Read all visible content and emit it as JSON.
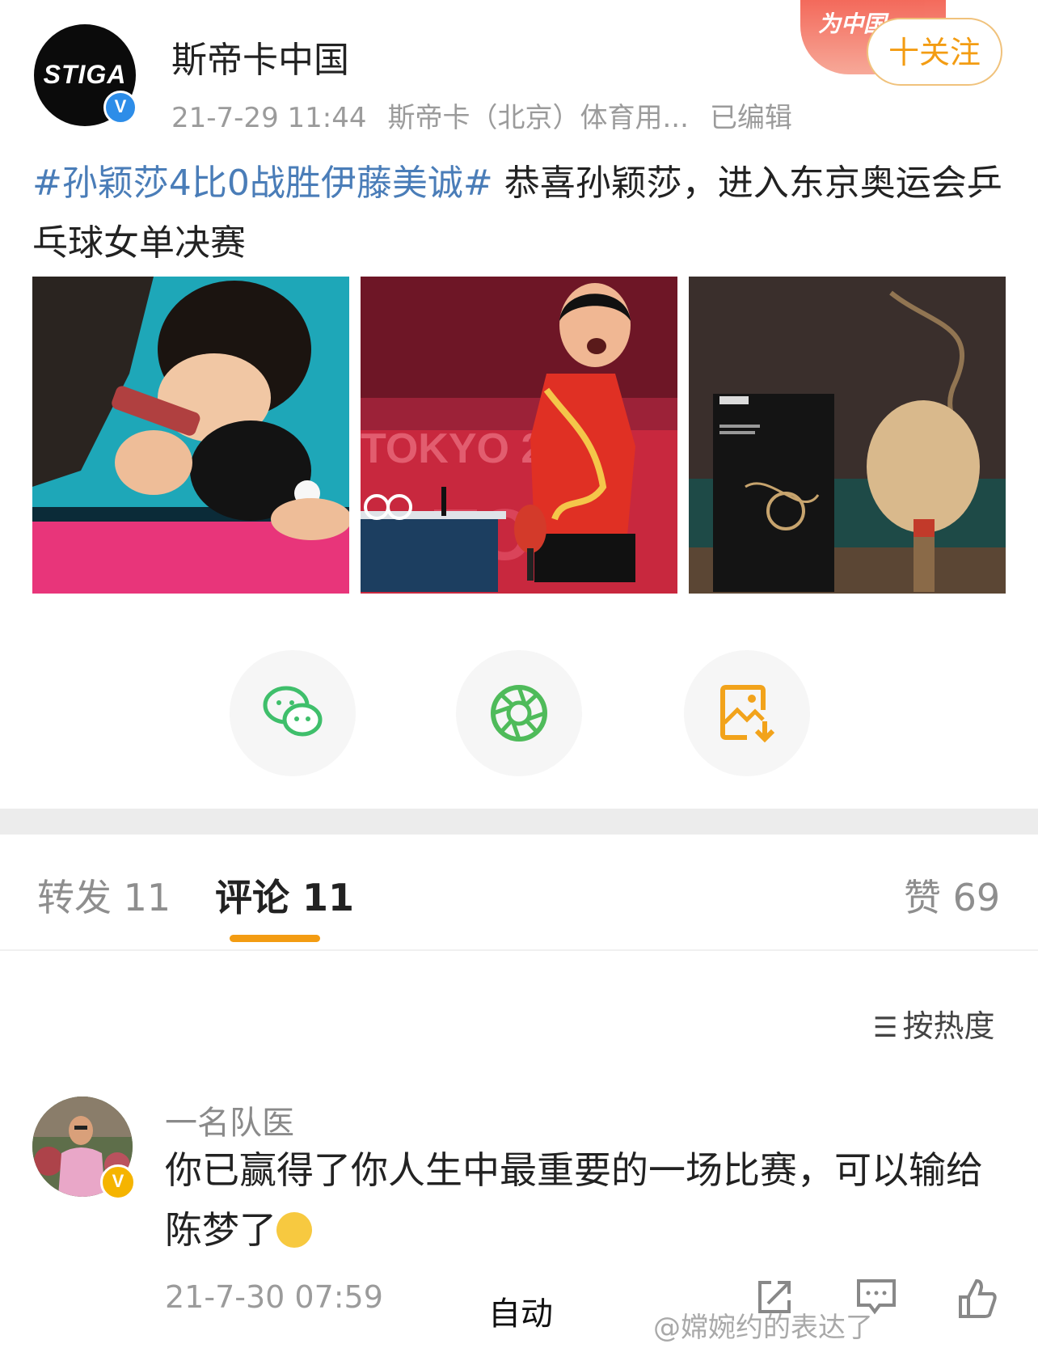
{
  "header": {
    "author_name": "斯帝卡中国",
    "avatar_logo_text": "STIGA",
    "verified_mark": "V",
    "timestamp": "21-7-29 11:44",
    "source": "斯帝卡（北京）体育用...",
    "edited": "已编辑",
    "promo_banner_text": "为中国",
    "follow_label": "十关注"
  },
  "post": {
    "hashtag": "#孙颖莎4比0战胜伊藤美诚#",
    "text": " 恭喜孙颖莎，进入东京奥运会乒乓球女单决赛",
    "photos": [
      "player-serving-photo",
      "player-celebrating-photo",
      "dragon-blade-product-photo"
    ]
  },
  "share": {
    "buttons": [
      "wechat-icon",
      "moments-icon",
      "save-image-icon"
    ]
  },
  "tabs": {
    "repost": "转发 11",
    "comments": "评论 11",
    "likes": "赞 69",
    "active": "comments"
  },
  "sort": {
    "label": "按热度"
  },
  "comment": {
    "author": "一名队医",
    "badge": "V",
    "text": "你已赢得了你人生中最重要的一场比赛，可以输给陈梦了",
    "timestamp": "21-7-30 07:59",
    "overlay_label": "自动"
  },
  "watermark": "@嫦婉约的表达了",
  "colors": {
    "accent": "#f39c12",
    "hashtag": "#4a7db8",
    "verified_blue": "#2d8de8",
    "verified_gold": "#f5b400"
  }
}
